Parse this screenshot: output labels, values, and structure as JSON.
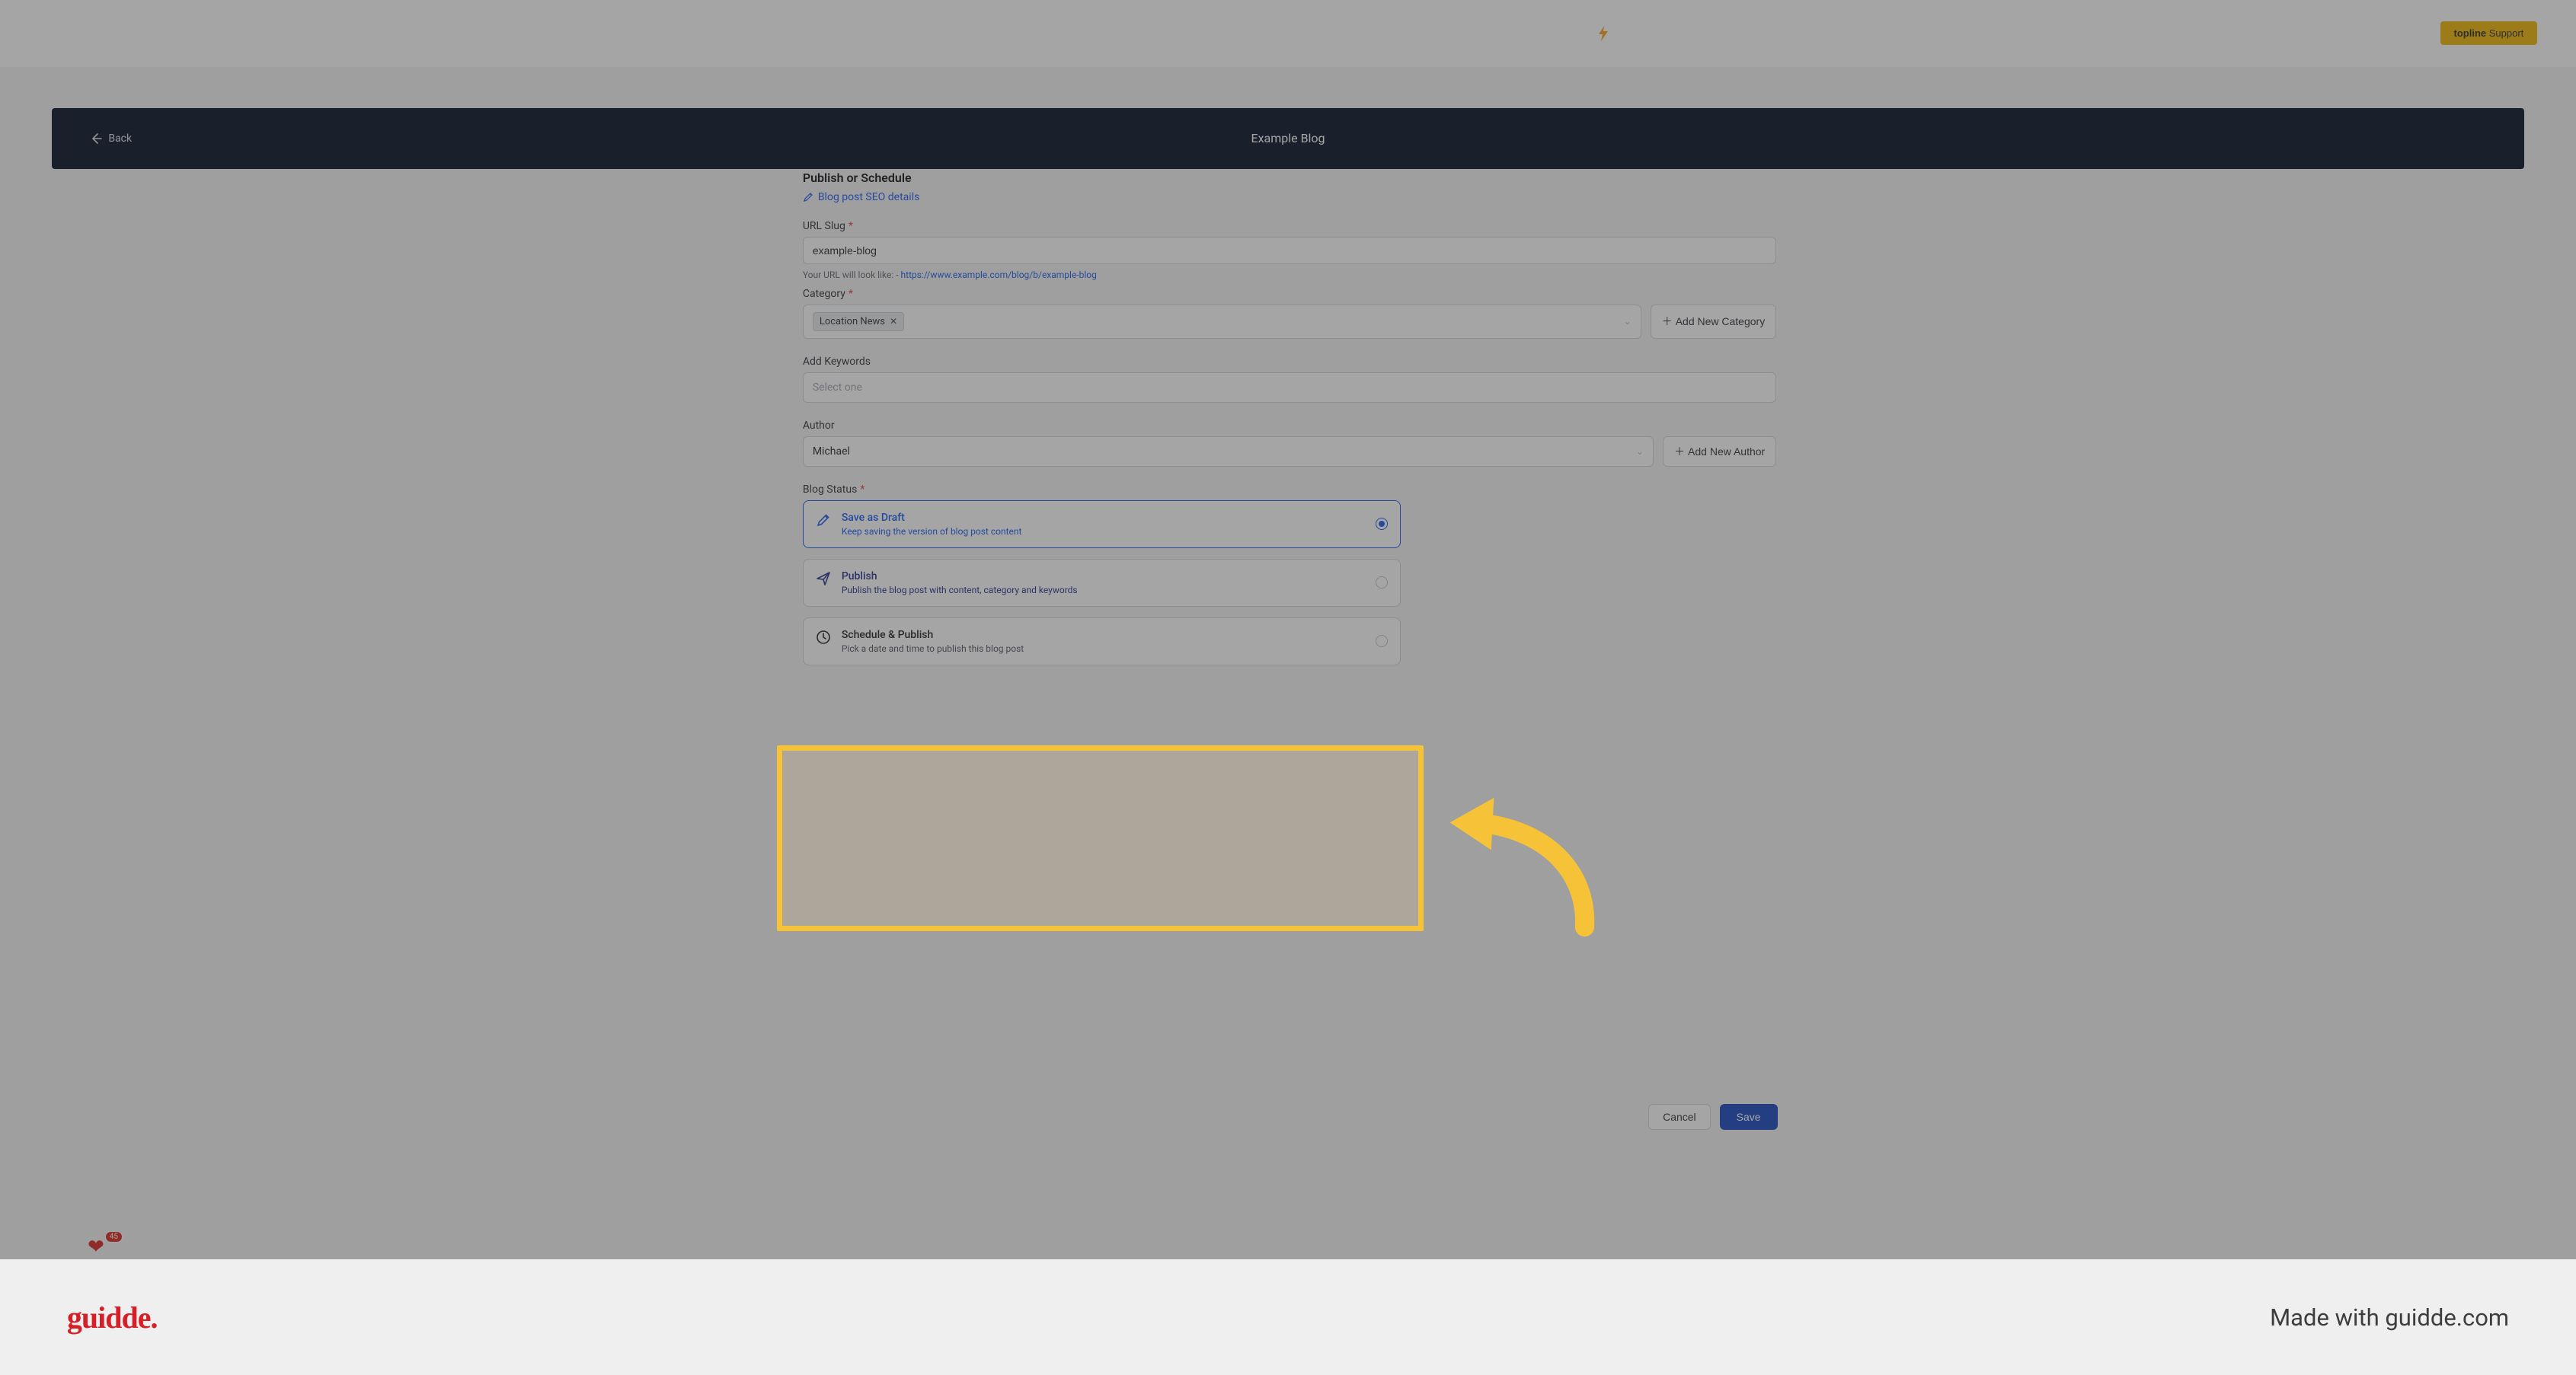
{
  "topbar": {
    "support_prefix": "topline",
    "support_suffix": " Support"
  },
  "header": {
    "back_label": "Back",
    "title": "Example Blog"
  },
  "section": {
    "title": "Publish or Schedule",
    "seo_link": "Blog post SEO details"
  },
  "url_slug": {
    "label": "URL Slug",
    "value": "example-blog",
    "helper_prefix": "Your URL will look like: - ",
    "helper_link": "https://www.example.com/blog/b/example-blog"
  },
  "category": {
    "label": "Category",
    "selected": "Location News",
    "add_button": "Add New Category"
  },
  "keywords": {
    "label": "Add Keywords",
    "placeholder": "Select one"
  },
  "author": {
    "label": "Author",
    "selected": "Michael",
    "add_button": "Add New Author"
  },
  "status": {
    "label": "Blog Status",
    "options": {
      "draft": {
        "title": "Save as Draft",
        "desc": "Keep saving the version of blog post content"
      },
      "publish": {
        "title": "Publish",
        "desc": "Publish the blog post with content, category and keywords"
      },
      "schedule": {
        "title": "Schedule & Publish",
        "desc": "Pick a date and time to publish this blog post"
      }
    }
  },
  "footer": {
    "cancel": "Cancel",
    "save": "Save"
  },
  "badge": {
    "count": "45"
  },
  "watermark": {
    "logo": "guidde.",
    "text": "Made with guidde.com"
  }
}
